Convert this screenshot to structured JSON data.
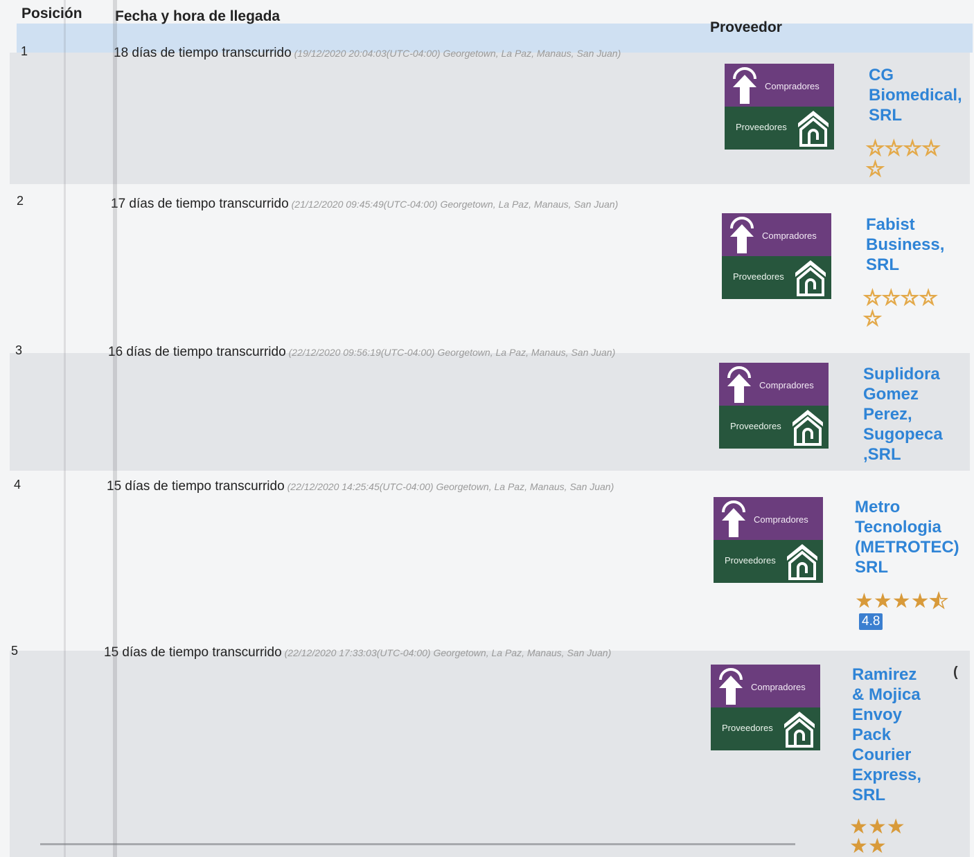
{
  "table": {
    "headers": {
      "posicion": "Posición",
      "fecha": "Fecha y hora de llegada",
      "proveedor": "Proveedor"
    },
    "rows": [
      {
        "position": "1",
        "elapsed": "18 días de tiempo transcurrido",
        "arrival": "(19/12/2020 20:04:03(UTC-04:00) Georgetown, La Paz, Manaus, San Juan)",
        "provider_lines": [
          "CG",
          "Biomedical,",
          "SRL"
        ],
        "rating_stars": "☆☆☆☆",
        "rating_stars_2": "☆",
        "rating_value": null
      },
      {
        "position": "2",
        "elapsed": "17 días de tiempo transcurrido",
        "arrival": "(21/12/2020 09:45:49(UTC-04:00) Georgetown, La Paz, Manaus, San Juan)",
        "provider_lines": [
          "Fabist",
          "Business,",
          "SRL"
        ],
        "rating_stars": "☆☆☆☆",
        "rating_stars_2": "☆",
        "rating_value": null
      },
      {
        "position": "3",
        "elapsed": "16 días de tiempo transcurrido",
        "arrival": "(22/12/2020 09:56:19(UTC-04:00) Georgetown, La Paz, Manaus, San Juan)",
        "provider_lines": [
          "Suplidora",
          "Gomez",
          "Perez,",
          "Sugopeca",
          ",SRL"
        ],
        "rating_stars": null,
        "rating_stars_2": null,
        "rating_value": null
      },
      {
        "position": "4",
        "elapsed": "15 días de tiempo transcurrido",
        "arrival": "(22/12/2020 14:25:45(UTC-04:00) Georgetown, La Paz, Manaus, San Juan)",
        "provider_lines": [
          "Metro",
          "Tecnologia",
          "(METROTEC)",
          "SRL"
        ],
        "rating_stars": "★★★★",
        "rating_stars_2": null,
        "rating_value": "4.8"
      },
      {
        "position": "5",
        "elapsed": "15 días de tiempo transcurrido",
        "arrival": "(22/12/2020 17:33:03(UTC-04:00) Georgetown, La Paz, Manaus, San Juan)",
        "provider_lines": [
          "Ramirez",
          "& Mojica",
          "Envoy",
          "Pack",
          "Courier",
          "Express,",
          "SRL"
        ],
        "rating_stars": "★★★",
        "rating_stars_2": "★★",
        "rating_value": null
      }
    ]
  },
  "logo": {
    "top_label": "Compradores",
    "bottom_label": "Proveedores",
    "top_color": "#6b3d7d",
    "bottom_color": "#27563d"
  },
  "stray_char": "(",
  "colors": {
    "header_band": "#cfe0f2",
    "link": "#2f84d6",
    "badge": "#3b7fd0",
    "star": "#d89a3a"
  }
}
